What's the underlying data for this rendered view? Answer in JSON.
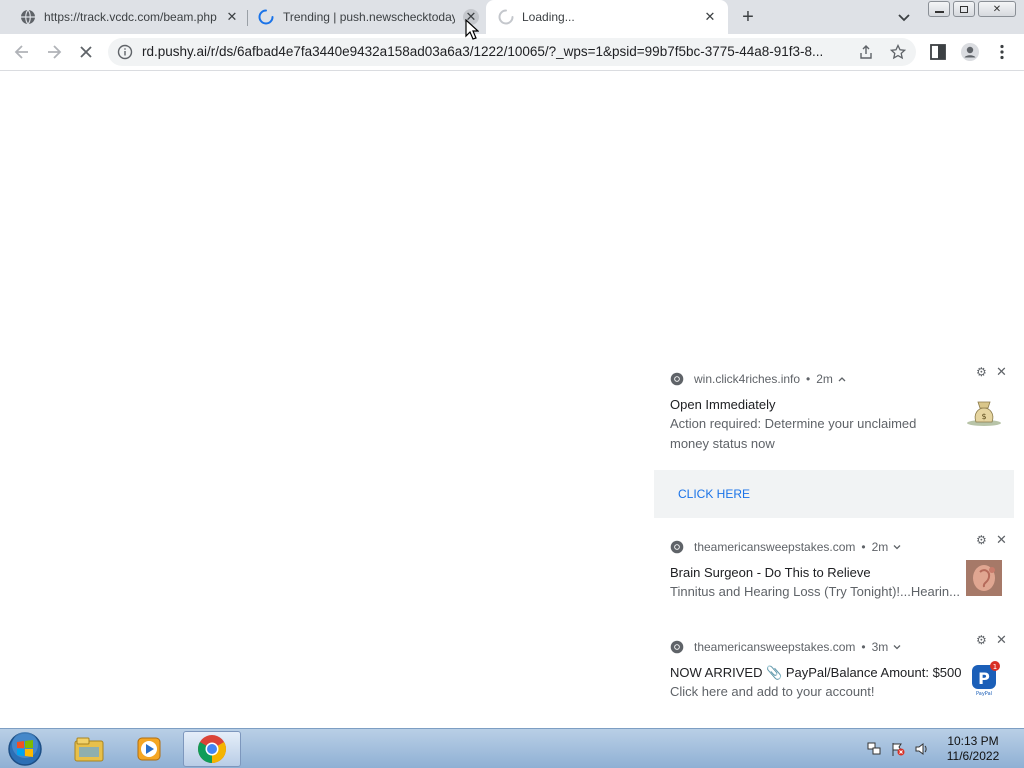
{
  "browser": {
    "tabs": [
      {
        "title": "https://track.vcdc.com/beam.php",
        "icon": "globe-icon",
        "state": "inactive"
      },
      {
        "title": "Trending | push.newschecktoday",
        "icon": "loading-spinner-icon",
        "state": "inactive"
      },
      {
        "title": "Loading...",
        "icon": "loading-spinner-icon",
        "state": "active"
      }
    ],
    "url": "rd.pushy.ai/r/ds/6afbad4e7fa3440e9432a158ad03a6a3/1222/10065/?_wps=1&psid=99b7f5bc-3775-44a8-91f3-8..."
  },
  "notifications": [
    {
      "origin": "win.click4riches.info",
      "age": "2m",
      "expanded": true,
      "title": "Open Immediately",
      "body": "Action required: Determine your unclaimed money status now",
      "action": "CLICK HERE",
      "thumb": "money-bag-icon"
    },
    {
      "origin": "theamericansweepstakes.com",
      "age": "2m",
      "expanded": false,
      "title": "Brain Surgeon - Do This to Relieve",
      "body": "Tinnitus and Hearing Loss (Try Tonight)!...Hearin...",
      "thumb": "ear-photo-icon"
    },
    {
      "origin": "theamericansweepstakes.com",
      "age": "3m",
      "expanded": false,
      "title": "NOW ARRIVED 📎 PayPal/Balance Amount: $500",
      "body": "Click here and add to your account!",
      "thumb": "paypal-icon",
      "thumb_badge": "1"
    }
  ],
  "taskbar": {
    "apps": [
      "file-explorer-icon",
      "media-player-icon",
      "chrome-icon"
    ],
    "time": "10:13 PM",
    "date": "11/6/2022"
  },
  "colors": {
    "tabstrip": "#dee1e6",
    "link": "#1a73e8",
    "taskbar": "#a7c2e0"
  }
}
